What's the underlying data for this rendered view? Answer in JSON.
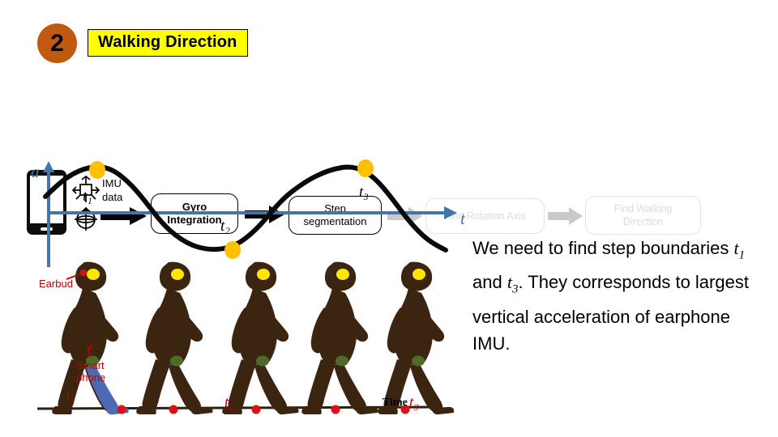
{
  "header": {
    "step_number": "2",
    "title": "Walking Direction",
    "badge_color": "#c15911",
    "title_bg": "#ffff00"
  },
  "pipeline": {
    "source_device": "smartphone-mock",
    "sensor_icons": [
      "accelerometer-icon",
      "gyroscope-icon"
    ],
    "data_label": "IMU\ndata",
    "data_label_line1": "IMU",
    "data_label_line2": "data",
    "stages": [
      {
        "id": "gyro-integration",
        "label": "Gyro Integration",
        "line1": "Gyro",
        "line2": "Integration",
        "state": "active"
      },
      {
        "id": "step-segmentation",
        "label": "Step segmentation",
        "line1": "Step",
        "line2": "segmentation",
        "state": "active"
      },
      {
        "id": "find-rotation-axis",
        "label": "Find Rotation Axis",
        "line1": "Find Rotation Axis",
        "line2": "",
        "state": "faded"
      },
      {
        "id": "find-walking-direction",
        "label": "Find Walking Direction",
        "line1": "Find Walking",
        "line2": "Direction",
        "state": "faded"
      }
    ],
    "arrow_active_color": "#000000",
    "arrow_faded_color": "#c9c9c9"
  },
  "chart_data": {
    "type": "line",
    "title": "",
    "xlabel": "t",
    "ylabel": "a",
    "axis_color": "#4575a8",
    "curve_color": "#000000",
    "marker_color": "#ffc000",
    "grid": false,
    "legend": null,
    "xlim": [
      0,
      10
    ],
    "ylim": [
      -1.15,
      1.15
    ],
    "series": [
      {
        "name": "vertical acceleration",
        "x": [
          0.0,
          0.5,
          1.0,
          1.5,
          2.0,
          2.5,
          3.0,
          3.5,
          4.0,
          4.5,
          5.0,
          5.5,
          6.0,
          6.5,
          7.0,
          7.5,
          8.0,
          8.5,
          9.0,
          9.5,
          10.0
        ],
        "y": [
          0.3,
          0.72,
          0.95,
          0.98,
          0.8,
          0.42,
          0.0,
          -0.42,
          -0.78,
          -0.95,
          -0.92,
          -0.7,
          -0.25,
          0.25,
          0.7,
          0.92,
          0.98,
          0.86,
          0.52,
          0.05,
          -0.45
        ]
      }
    ],
    "annotations": [
      {
        "label": "t1",
        "label_text": "t₁",
        "x": 1.45,
        "y": 0.98,
        "marker": true,
        "note": "first step boundary, peak"
      },
      {
        "label": "t2",
        "label_text": "t₂",
        "x": 4.75,
        "y": -0.95,
        "marker": true,
        "note": "mid-step, trough"
      },
      {
        "label": "t3",
        "label_text": "t₃",
        "x": 8.05,
        "y": 0.98,
        "marker": true,
        "note": "second step boundary, peak"
      }
    ]
  },
  "illustration": {
    "name": "walking-sequence",
    "figure_count": 5,
    "body_color": "#3b2410",
    "earbud_marker_color": "#ffe600",
    "foot_marker_color": "#dd1111",
    "pocket_marker_color": "#4f6b27",
    "phone_highlight_color": "#4d6fba",
    "annotations": {
      "earbud": "Earbud",
      "smartphone_line1": "Smart",
      "smartphone_line2": "phone"
    },
    "ground_labels": {
      "t1": "t₁",
      "t2": "t₂",
      "t3": "t₃",
      "time": "Time"
    },
    "annotation_color": "#c00000"
  },
  "explanation": {
    "seg1": "We need to find step boundaries ",
    "var1": "t",
    "var1_sub": "1",
    "seg2": " and ",
    "var2": "t",
    "var2_sub": "3",
    "seg3": ". They corresponds to largest vertical acceleration of earphone IMU.",
    "full_text": "We need to find step boundaries t1 and t3. They corresponds to largest vertical acceleration of earphone IMU."
  }
}
